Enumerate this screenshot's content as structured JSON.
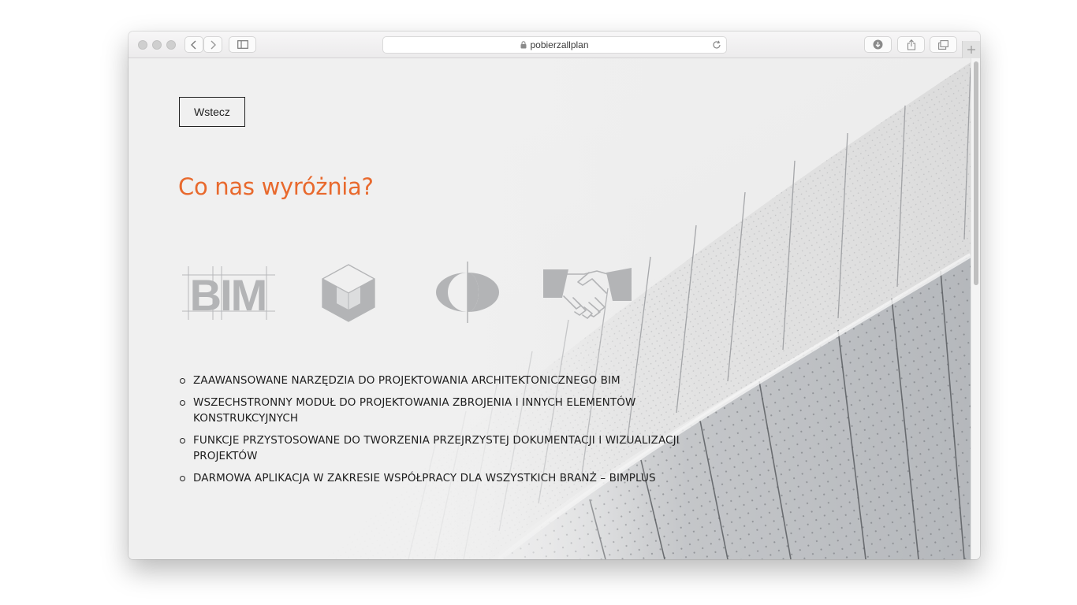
{
  "browser": {
    "url": "pobierzallplan",
    "buttons": [
      "back-arrow-icon",
      "forward-arrow-icon",
      "sidebar-icon",
      "reload-icon",
      "download-icon",
      "share-icon",
      "tabs-overview-icon",
      "new-tab-icon"
    ]
  },
  "page": {
    "back_button": "Wstecz",
    "heading": "Co nas wyróżnia?",
    "icons": [
      "bim-icon",
      "cube-icon",
      "eye-lens-icon",
      "handshake-icon"
    ],
    "bim_text": "BIM",
    "features": [
      {
        "text": "ZAAWANSOWANE NARZĘDZIA DO PROJEKTOWANIA ARCHITEKTONICZNEGO BIM"
      },
      {
        "text": "WSZECHSTRONNY MODUŁ DO PROJEKTOWANIA ZBROJENIA I INNYCH ELEMENTÓW KONSTRUKCYJNYCH"
      },
      {
        "text": "FUNKCJE PRZYSTOSOWANE DO TWORZENIA PRZEJRZYSTEJ DOKUMENTACJI I WIZUALIZACJI PROJEKTÓW"
      },
      {
        "text": "DARMOWA APLIKACJA W ZAKRESIE WSPÓŁPRACY DLA WSZYSTKICH BRANŻ – BIMPLUS"
      }
    ],
    "colors": {
      "accent": "#e8692d",
      "icon_gray": "#b3b4b6",
      "text": "#1e1e1e"
    }
  }
}
